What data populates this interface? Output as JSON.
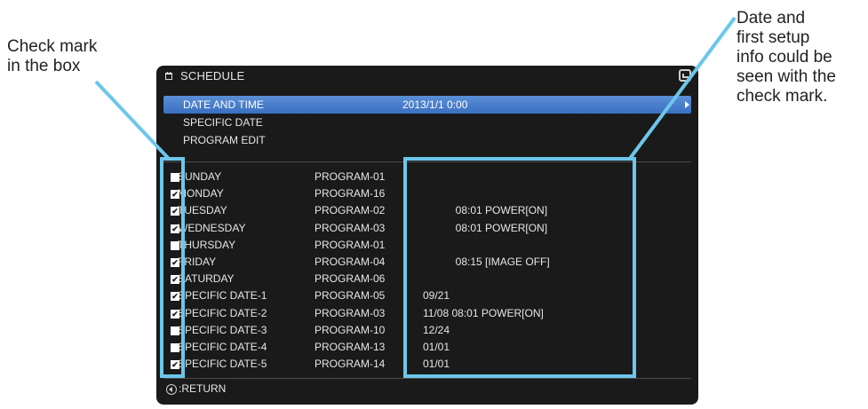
{
  "annotations": {
    "left_text": "Check mark\nin the box",
    "right_text": "Date and\nfirst setup\ninfo could be\nseen with the\ncheck mark.",
    "highlight_color": "#6cc7ea"
  },
  "screen": {
    "title": "SCHEDULE",
    "title_icon": "schedule-icon",
    "menu": [
      {
        "label": "DATE AND TIME",
        "value": "2013/1/1  0:00"
      },
      {
        "label": "SPECIFIC DATE",
        "value": ""
      },
      {
        "label": "PROGRAM EDIT",
        "value": ""
      }
    ],
    "schedule_rows": [
      {
        "day": "SUNDAY",
        "program": "PROGRAM-01",
        "info": "",
        "checked": false
      },
      {
        "day": "MONDAY",
        "program": "PROGRAM-16",
        "info": "",
        "checked": true
      },
      {
        "day": "TUESDAY",
        "program": "PROGRAM-02",
        "info": "           08:01 POWER[ON]",
        "checked": true
      },
      {
        "day": "WEDNESDAY",
        "program": "PROGRAM-03",
        "info": "           08:01 POWER[ON]",
        "checked": true
      },
      {
        "day": "THURSDAY",
        "program": "PROGRAM-01",
        "info": "",
        "checked": false
      },
      {
        "day": "FRIDAY",
        "program": "PROGRAM-04",
        "info": "           08:15 [IMAGE OFF]",
        "checked": true
      },
      {
        "day": "SATURDAY",
        "program": "PROGRAM-06",
        "info": "",
        "checked": true
      },
      {
        "day": "SPECIFIC DATE-1",
        "program": "PROGRAM-05",
        "info": "09/21",
        "checked": true
      },
      {
        "day": "SPECIFIC DATE-2",
        "program": "PROGRAM-03",
        "info": "11/08 08:01 POWER[ON]",
        "checked": true
      },
      {
        "day": "SPECIFIC DATE-3",
        "program": "PROGRAM-10",
        "info": "12/24",
        "checked": false
      },
      {
        "day": "SPECIFIC DATE-4",
        "program": "PROGRAM-13",
        "info": "01/01",
        "checked": false
      },
      {
        "day": "SPECIFIC DATE-5",
        "program": "PROGRAM-14",
        "info": "01/01",
        "checked": true
      }
    ],
    "footer_label": ":RETURN",
    "accent_color": "#3a6fc1"
  }
}
